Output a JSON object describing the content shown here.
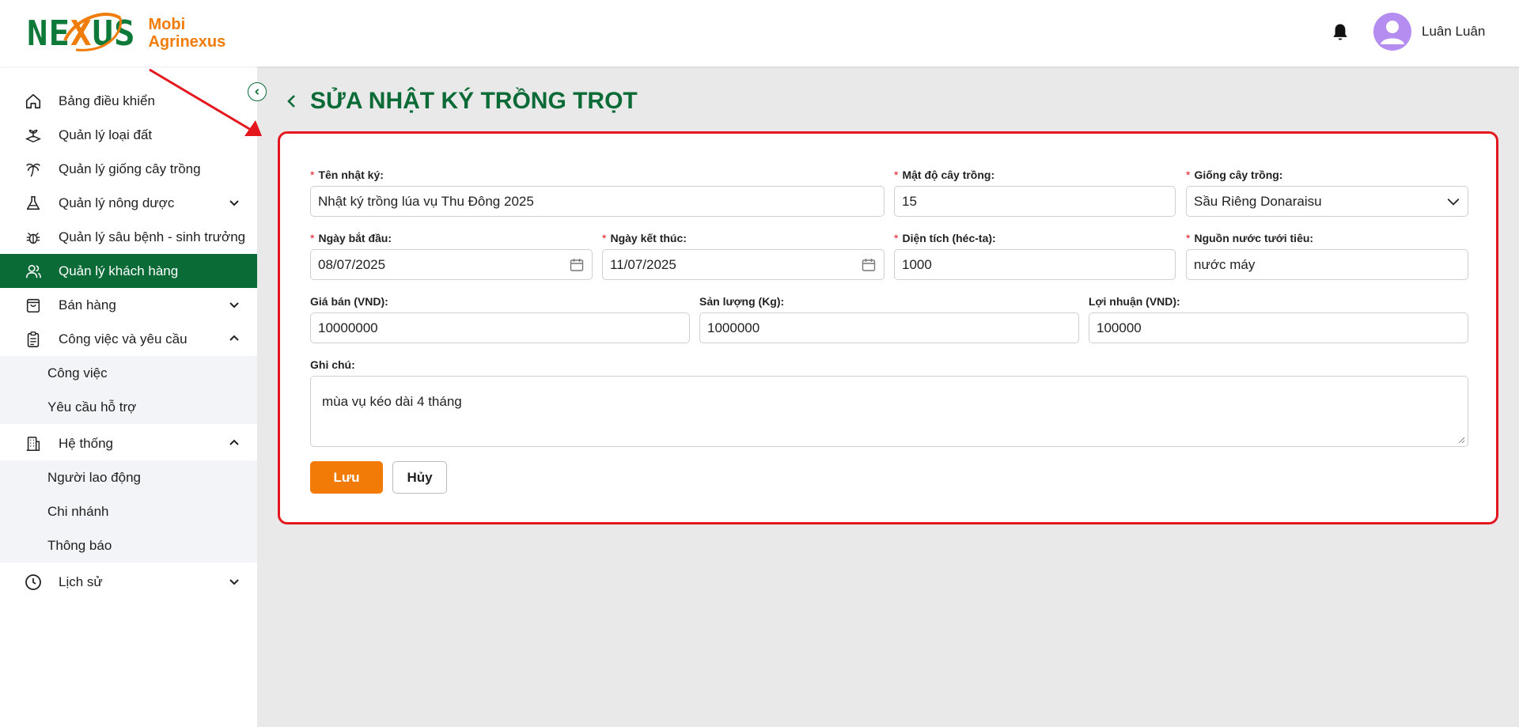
{
  "brand": {
    "logo_text": "NEXUS",
    "name_line1": "Mobi",
    "name_line2": "Agrinexus"
  },
  "header": {
    "username": "Luân Luân"
  },
  "sidebar": {
    "items": [
      {
        "label": "Bảng điều khiển",
        "icon": "home-icon"
      },
      {
        "label": "Quản lý loại đất",
        "icon": "soil-plant-icon"
      },
      {
        "label": "Quản lý giống cây trồng",
        "icon": "palm-tree-icon"
      },
      {
        "label": "Quản lý nông dược",
        "icon": "flask-icon"
      },
      {
        "label": "Quản lý sâu bệnh - sinh trưởng",
        "icon": "bug-icon"
      },
      {
        "label": "Quản lý khách hàng",
        "icon": "users-icon"
      },
      {
        "label": "Bán hàng",
        "icon": "shopping-bag-icon"
      },
      {
        "label": "Công việc và yêu cầu",
        "icon": "clipboard-icon"
      },
      {
        "label": "Hệ thống",
        "icon": "building-icon"
      },
      {
        "label": "Lịch sử",
        "icon": "clock-icon"
      }
    ],
    "work_sub": [
      "Công việc",
      "Yêu cầu hỗ trợ"
    ],
    "system_sub": [
      "Người lao động",
      "Chi nhánh",
      "Thông báo"
    ]
  },
  "page": {
    "title": "SỬA NHẬT KÝ TRỒNG TRỌT"
  },
  "form": {
    "name": {
      "label": "Tên nhật ký:",
      "value": "Nhật ký trồng lúa vụ Thu Đông 2025"
    },
    "density": {
      "label": "Mật độ cây trồng:",
      "value": "15"
    },
    "variety": {
      "label": "Giống cây trồng:",
      "value": "Sầu Riêng Donaraisu"
    },
    "start_date": {
      "label": "Ngày bắt đầu:",
      "value": "08/07/2025"
    },
    "end_date": {
      "label": "Ngày kết thúc:",
      "value": "11/07/2025"
    },
    "area": {
      "label": "Diện tích (héc-ta):",
      "value": "1000"
    },
    "water": {
      "label": "Nguồn nước tưới tiêu:",
      "value": "nước máy"
    },
    "price": {
      "label": "Giá bán (VND):",
      "value": "10000000"
    },
    "yield": {
      "label": "Sản lượng (Kg):",
      "value": "1000000"
    },
    "profit": {
      "label": "Lợi nhuận (VND):",
      "value": "100000"
    },
    "note": {
      "label": "Ghi chú:",
      "value": "mùa vụ kéo dài 4 tháng"
    },
    "save_label": "Lưu",
    "cancel_label": "Hủy"
  },
  "colors": {
    "primary_green": "#0b6b37",
    "accent_orange": "#f27b08",
    "highlight_red": "#e4171e"
  }
}
